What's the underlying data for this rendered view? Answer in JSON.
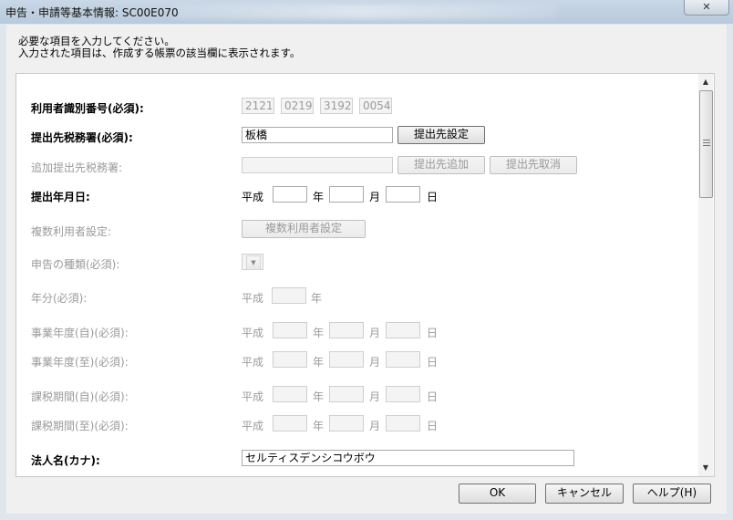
{
  "window": {
    "title": "申告・申請等基本情報: SC00E070",
    "close_label": "✕"
  },
  "instructions": {
    "line1": "必要な項目を入力してください。",
    "line2": "入力された項目は、作成する帳票の該当欄に表示されます。"
  },
  "form": {
    "user_id": {
      "label": "利用者識別番号(必須):",
      "values": [
        "2121",
        "0219",
        "3192",
        "0054"
      ]
    },
    "tax_office": {
      "label": "提出先税務署(必須):",
      "value": "板橋",
      "button": "提出先設定"
    },
    "add_tax_office": {
      "label": "追加提出先税務署:",
      "value": "",
      "add_button": "提出先追加",
      "remove_button": "提出先取消"
    },
    "submit_date": {
      "label": "提出年月日:",
      "era": "平成",
      "year_unit": "年",
      "month_unit": "月",
      "day_unit": "日"
    },
    "multi_user": {
      "label": "複数利用者設定:",
      "button": "複数利用者設定"
    },
    "declaration_type": {
      "label": "申告の種類(必須):",
      "arrow": "▼"
    },
    "year": {
      "label": "年分(必須):",
      "era": "平成",
      "year_unit": "年"
    },
    "fiscal_from": {
      "label": "事業年度(自)(必須):",
      "era": "平成",
      "year_unit": "年",
      "month_unit": "月",
      "day_unit": "日"
    },
    "fiscal_to": {
      "label": "事業年度(至)(必須):",
      "era": "平成",
      "year_unit": "年",
      "month_unit": "月",
      "day_unit": "日"
    },
    "tax_period_from": {
      "label": "課税期間(自)(必須):",
      "era": "平成",
      "year_unit": "年",
      "month_unit": "月",
      "day_unit": "日"
    },
    "tax_period_to": {
      "label": "課税期間(至)(必須):",
      "era": "平成",
      "year_unit": "年",
      "month_unit": "月",
      "day_unit": "日"
    },
    "corp_kana": {
      "label": "法人名(カナ):",
      "value": "セルティスデンシコウボウ"
    }
  },
  "footer": {
    "ok": "OK",
    "cancel": "キャンセル",
    "help": "ヘルプ(H)"
  }
}
